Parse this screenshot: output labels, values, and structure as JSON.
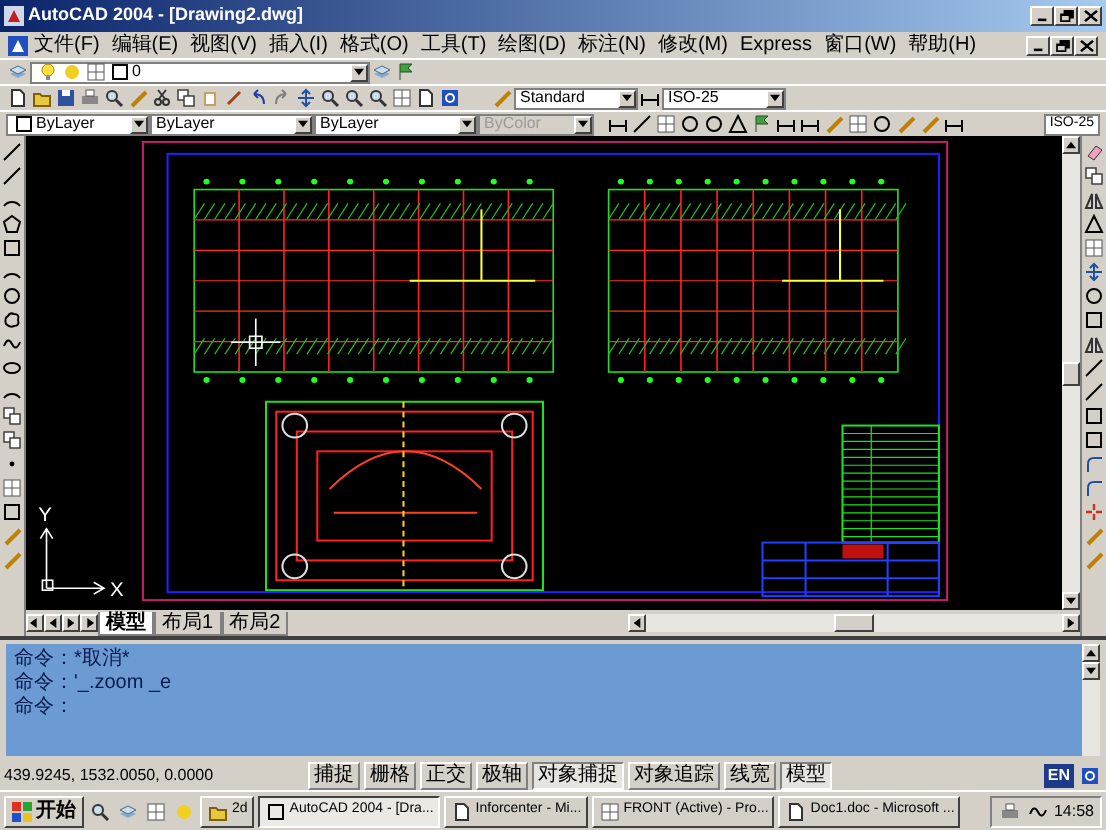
{
  "window": {
    "title": "AutoCAD 2004 - [Drawing2.dwg]"
  },
  "menu": [
    "文件(F)",
    "编辑(E)",
    "视图(V)",
    "插入(I)",
    "格式(O)",
    "工具(T)",
    "绘图(D)",
    "标注(N)",
    "修改(M)",
    "Express",
    "窗口(W)",
    "帮助(H)"
  ],
  "layer_toolbar": {
    "layer": "0"
  },
  "style_toolbar": {
    "text_style": "Standard",
    "dim_style": "ISO-25"
  },
  "properties_toolbar": {
    "color_setting": "ByLayer",
    "linetype": "ByLayer",
    "lineweight": "ByLayer",
    "plot_style": "ByColor",
    "plot_style_disabled": true
  },
  "dimension_toolbar": {
    "dim_style": "ISO-25"
  },
  "ucs_icon": {
    "x_label": "X",
    "y_label": "Y"
  },
  "layout_tabs": [
    {
      "label": "模型",
      "selected": true
    },
    {
      "label": "布局1",
      "selected": false
    },
    {
      "label": "布局2",
      "selected": false
    }
  ],
  "command_lines": [
    "命令：*取消*",
    "命令：'_.zoom _e",
    "命令："
  ],
  "status_bar": {
    "coordinates": "439.9245, 1532.0050, 0.0000",
    "toggles": [
      {
        "label": "捕捉",
        "on": false
      },
      {
        "label": "栅格",
        "on": false
      },
      {
        "label": "正交",
        "on": false
      },
      {
        "label": "极轴",
        "on": false
      },
      {
        "label": "对象捕捉",
        "on": true
      },
      {
        "label": "对象追踪",
        "on": false
      },
      {
        "label": "线宽",
        "on": false
      },
      {
        "label": "模型",
        "on": true
      }
    ],
    "ime": "EN"
  },
  "taskbar": {
    "start": "开始",
    "buttons": [
      {
        "label": "2d",
        "selected": false
      },
      {
        "label": "AutoCAD 2004 - [Dra...",
        "selected": true
      },
      {
        "label": "Inforcenter - Mi...",
        "selected": false
      },
      {
        "label": "FRONT (Active) - Pro...",
        "selected": false
      },
      {
        "label": "Doc1.doc - Microsoft ...",
        "selected": false
      }
    ],
    "clock": "14:58"
  }
}
